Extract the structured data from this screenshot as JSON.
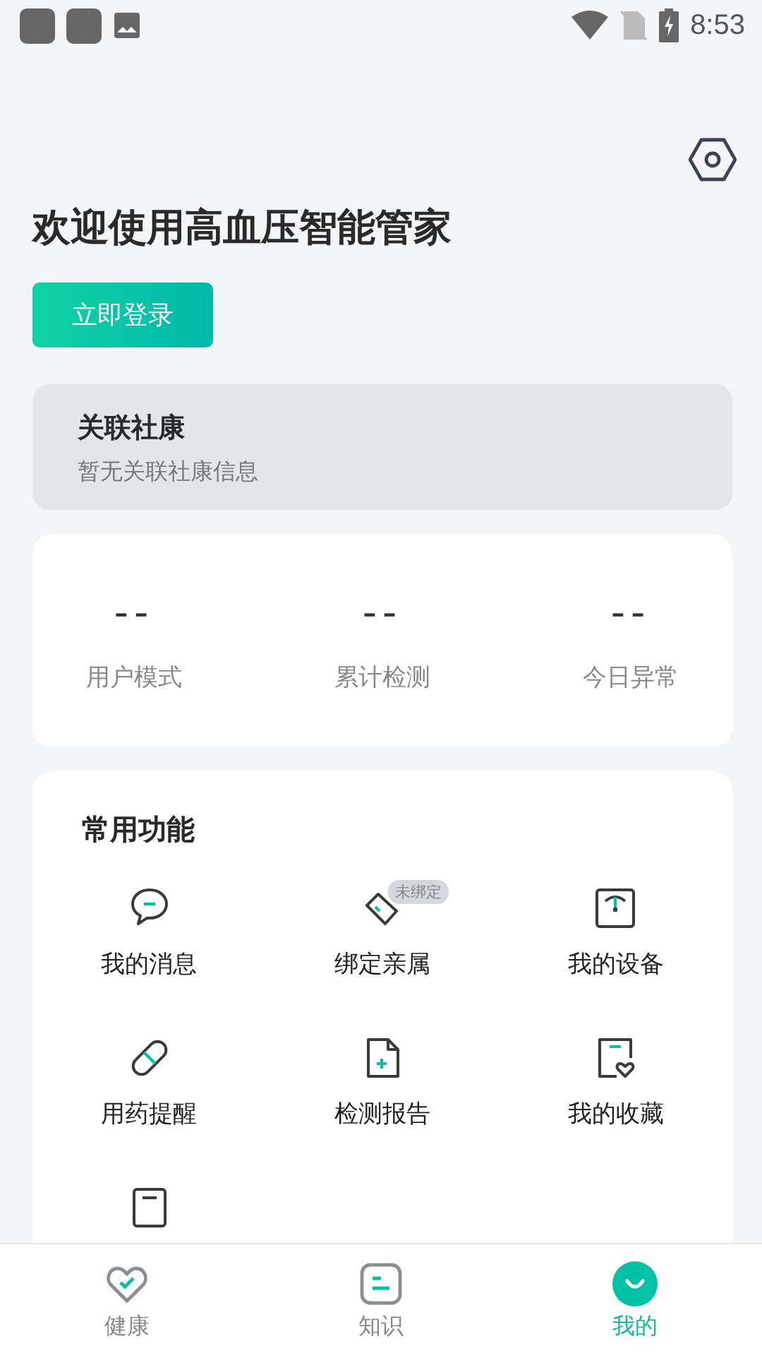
{
  "status_bar": {
    "time": "8:53"
  },
  "header": {
    "title": "欢迎使用高血压智能管家",
    "login_button": "立即登录"
  },
  "linked_community": {
    "title": "关联社康",
    "subtitle": "暂无关联社康信息"
  },
  "stats": [
    {
      "value": "--",
      "label": "用户模式"
    },
    {
      "value": "--",
      "label": "累计检测"
    },
    {
      "value": "--",
      "label": "今日异常"
    }
  ],
  "functions": {
    "title": "常用功能",
    "items": [
      {
        "kind": "message",
        "label": "我的消息"
      },
      {
        "kind": "bind",
        "label": "绑定亲属",
        "badge": "未绑定"
      },
      {
        "kind": "device",
        "label": "我的设备"
      },
      {
        "kind": "pill",
        "label": "用药提醒"
      },
      {
        "kind": "report",
        "label": "检测报告"
      },
      {
        "kind": "favorite",
        "label": "我的收藏"
      },
      {
        "kind": "list"
      }
    ]
  },
  "bottom_nav": [
    {
      "kind": "health",
      "label": "健康",
      "selected": false
    },
    {
      "kind": "knowledge",
      "label": "知识",
      "selected": false
    },
    {
      "kind": "mine",
      "label": "我的",
      "selected": true
    }
  ]
}
